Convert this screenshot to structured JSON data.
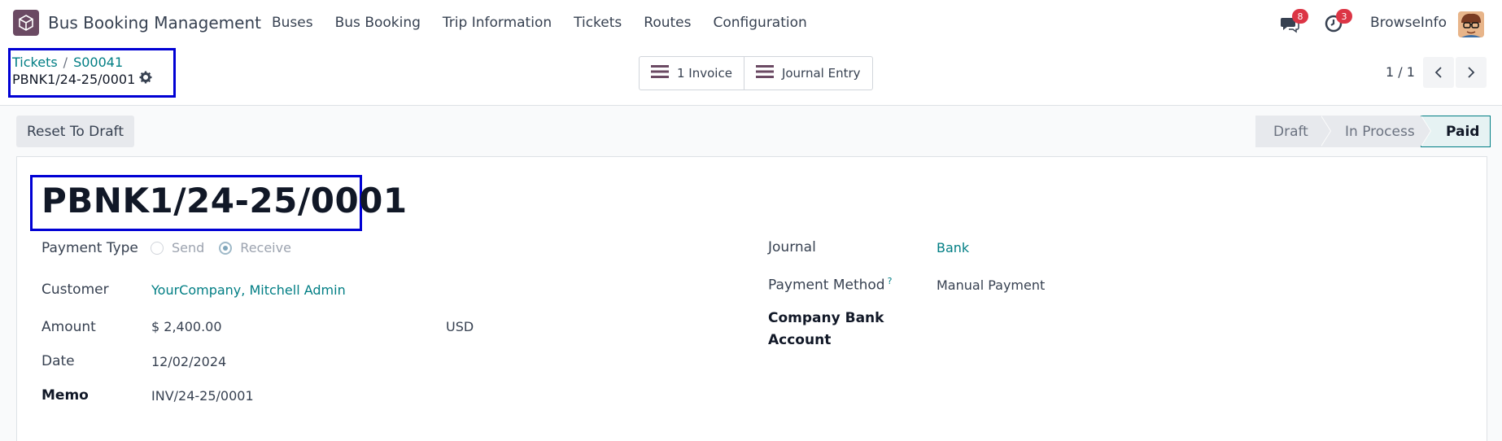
{
  "navbar": {
    "app_title": "Bus Booking Management",
    "menu": [
      "Buses",
      "Bus Booking",
      "Trip Information",
      "Tickets",
      "Routes",
      "Configuration"
    ],
    "messages_badge": "8",
    "activities_badge": "3",
    "company": "BrowseInfo"
  },
  "control_panel": {
    "breadcrumb": {
      "parent": "Tickets",
      "separator": "/",
      "ticket": "S00041"
    },
    "record_name": "PBNK1/24-25/0001",
    "smart_buttons": {
      "invoice": "1 Invoice",
      "journal_entry": "Journal Entry"
    },
    "pager": "1 / 1"
  },
  "actions": {
    "reset_to_draft": "Reset To Draft"
  },
  "statusbar": {
    "stages": [
      "Draft",
      "In Process",
      "Paid"
    ],
    "active": "Paid"
  },
  "form": {
    "title": "PBNK1/24-25/0001",
    "payment_type": {
      "label": "Payment Type",
      "options": [
        "Send",
        "Receive"
      ],
      "selected": "Receive"
    },
    "customer": {
      "label": "Customer",
      "value": "YourCompany, Mitchell Admin"
    },
    "amount": {
      "label": "Amount",
      "value": "$ 2,400.00",
      "currency": "USD"
    },
    "date": {
      "label": "Date",
      "value": "12/02/2024"
    },
    "memo": {
      "label": "Memo",
      "value": "INV/24-25/0001"
    },
    "journal": {
      "label": "Journal",
      "value": "Bank"
    },
    "payment_method": {
      "label": "Payment Method",
      "help": "?",
      "value": "Manual Payment"
    },
    "company_bank_account": {
      "label_line1": "Company Bank",
      "label_line2": "Account"
    }
  },
  "colors": {
    "accent": "#017e84",
    "brand": "#714b67",
    "highlight_border": "#0000d4",
    "badge": "#dc3545"
  }
}
